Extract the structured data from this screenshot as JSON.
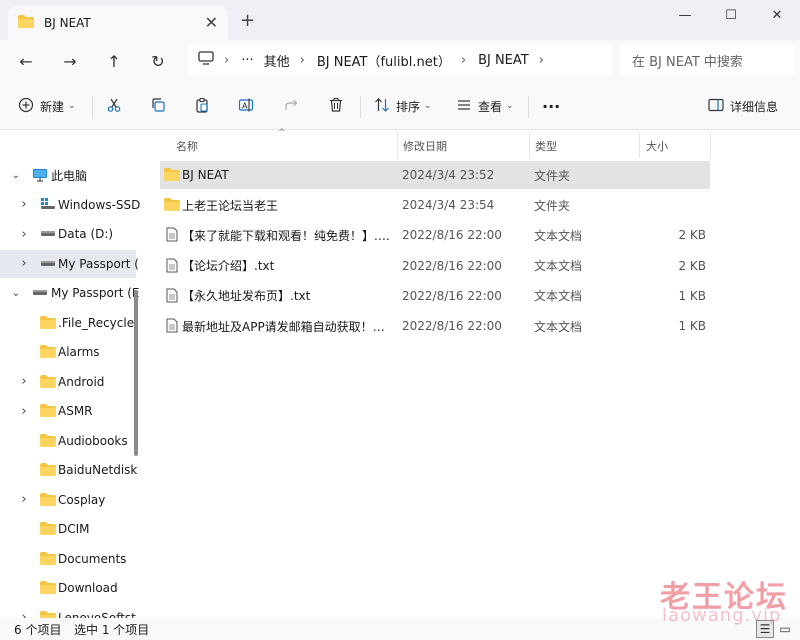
{
  "window": {
    "tab_title": "BJ NEAT",
    "tab_close": "✕",
    "new_tab": "+",
    "minimize": "—",
    "maximize": "☐",
    "close": "✕"
  },
  "nav": {
    "back": "←",
    "forward": "→",
    "up": "↑",
    "refresh": "↻"
  },
  "breadcrumb": {
    "more": "···",
    "segments": [
      "其他",
      "BJ NEAT（fulibl.net）",
      "BJ NEAT"
    ]
  },
  "search": {
    "placeholder": "在 BJ NEAT 中搜索"
  },
  "toolbar": {
    "new_label": "新建",
    "sort_label": "排序",
    "view_label": "查看",
    "more": "···",
    "details_label": "详细信息"
  },
  "sidebar": {
    "items": [
      {
        "label": "此电脑",
        "icon": "monitor-icon",
        "level": 0,
        "expand": "expanded"
      },
      {
        "label": "Windows-SSD",
        "icon": "windows-drive-icon",
        "level": 1,
        "expand": "collapsed"
      },
      {
        "label": "Data (D:)",
        "icon": "drive-icon",
        "level": 1,
        "expand": "collapsed"
      },
      {
        "label": "My Passport (",
        "icon": "drive-icon",
        "level": 1,
        "expand": "collapsed",
        "selected": true
      },
      {
        "label": "My Passport (E",
        "icon": "drive-icon",
        "level": 0,
        "expand": "expanded"
      },
      {
        "label": ".File_Recycle",
        "icon": "folder-icon",
        "level": 1,
        "expand": ""
      },
      {
        "label": "Alarms",
        "icon": "folder-icon",
        "level": 1,
        "expand": ""
      },
      {
        "label": "Android",
        "icon": "folder-icon",
        "level": 1,
        "expand": "collapsed"
      },
      {
        "label": "ASMR",
        "icon": "folder-icon",
        "level": 1,
        "expand": "collapsed"
      },
      {
        "label": "Audiobooks",
        "icon": "folder-icon",
        "level": 1,
        "expand": ""
      },
      {
        "label": "BaiduNetdisk",
        "icon": "folder-icon",
        "level": 1,
        "expand": ""
      },
      {
        "label": "Cosplay",
        "icon": "folder-icon",
        "level": 1,
        "expand": "collapsed"
      },
      {
        "label": "DCIM",
        "icon": "folder-icon",
        "level": 1,
        "expand": ""
      },
      {
        "label": "Documents",
        "icon": "folder-icon",
        "level": 1,
        "expand": ""
      },
      {
        "label": "Download",
        "icon": "folder-icon",
        "level": 1,
        "expand": ""
      },
      {
        "label": "LenovoSoftst",
        "icon": "folder-icon",
        "level": 1,
        "expand": "collapsed"
      }
    ]
  },
  "columns": {
    "name": "名称",
    "modified": "修改日期",
    "type": "类型",
    "size": "大小"
  },
  "files": [
    {
      "name": "BJ NEAT",
      "modified": "2024/3/4 23:52",
      "type": "文件夹",
      "size": "",
      "icon": "folder-icon",
      "selected": true
    },
    {
      "name": "上老王论坛当老王",
      "modified": "2024/3/4 23:54",
      "type": "文件夹",
      "size": "",
      "icon": "folder-icon"
    },
    {
      "name": "【来了就能下载和观看！纯免费！】.txt",
      "modified": "2022/8/16 22:00",
      "type": "文本文档",
      "size": "2 KB",
      "icon": "text-file-icon"
    },
    {
      "name": "【论坛介绍】.txt",
      "modified": "2022/8/16 22:00",
      "type": "文本文档",
      "size": "2 KB",
      "icon": "text-file-icon"
    },
    {
      "name": "【永久地址发布页】.txt",
      "modified": "2022/8/16 22:00",
      "type": "文本文档",
      "size": "1 KB",
      "icon": "text-file-icon"
    },
    {
      "name": "最新地址及APP请发邮箱自动获取！！！...",
      "modified": "2022/8/16 22:00",
      "type": "文本文档",
      "size": "1 KB",
      "icon": "text-file-icon"
    }
  ],
  "status": {
    "count": "6 个项目",
    "selected": "选中 1 个项目"
  },
  "watermark": {
    "text": "老王论坛",
    "url": "laowang.vip"
  },
  "colors": {
    "folder": "#f4c542",
    "accent": "#0067c0",
    "selected_row": "#e3e3e3",
    "watermark": "#e6505a"
  }
}
